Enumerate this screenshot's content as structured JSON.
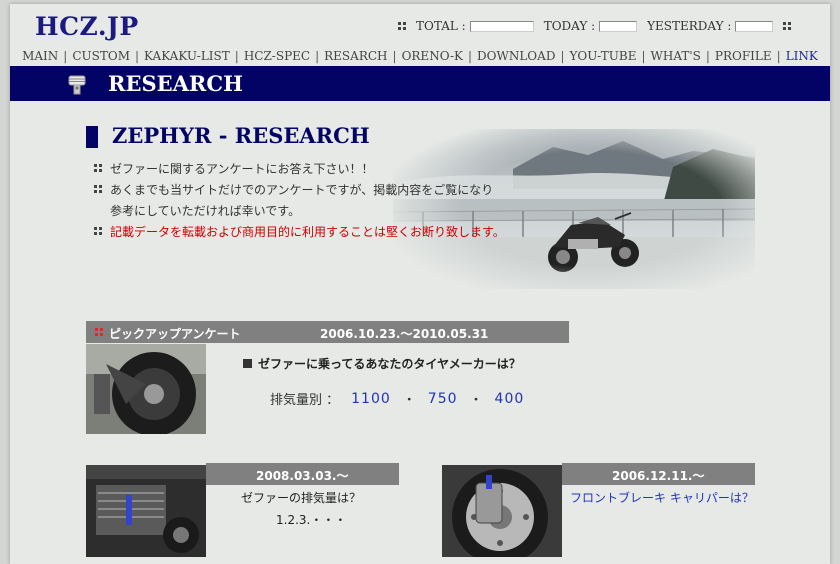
{
  "header": {
    "site_title": "HCZ.JP",
    "counters": [
      {
        "label": "TOTAL :"
      },
      {
        "label": "TODAY :"
      },
      {
        "label": "YESTERDAY :"
      }
    ]
  },
  "nav": {
    "items": [
      "MAIN",
      "CUSTOM",
      "KAKAKU-LIST",
      "HCZ-SPEC",
      "RESARCH",
      "ORENO-K",
      "DOWNLOAD",
      "YOU-TUBE",
      "WHAT'S",
      "PROFILE",
      "LINK"
    ],
    "separator": "|"
  },
  "section": {
    "title": "RESEARCH"
  },
  "research": {
    "heading": "ZEPHYR - RESEARCH",
    "lines": [
      "ゼファーに関するアンケートにお答え下さい！！",
      "あくまでも当サイトだけでのアンケートですが、掲載内容をご覧になり",
      "参考にしていただければ幸いです。",
      "記載データを転載および商用目的に利用することは堅くお断り致します。"
    ]
  },
  "pickup": {
    "label": "ピックアップアンケート",
    "date": "2006.10.23.～2010.05.31",
    "question": "ゼファーに乗ってるあなたのタイヤメーカーは？",
    "cc_label": "排気量別 ：",
    "cc_options": [
      "1100",
      "750",
      "400"
    ],
    "cc_sep": "・"
  },
  "survey_left": {
    "date": "2008.03.03.～",
    "question": "ゼファーの排気量は？",
    "answer": "1.2.3.・・・"
  },
  "survey_right": {
    "date": "2006.12.11.～",
    "question": "フロントブレーキ キャリパーは？"
  },
  "colors": {
    "brand_navy": "#030366",
    "header_gray": "#808080",
    "warning_red": "#cc0000",
    "link_blue": "#2233bb"
  }
}
